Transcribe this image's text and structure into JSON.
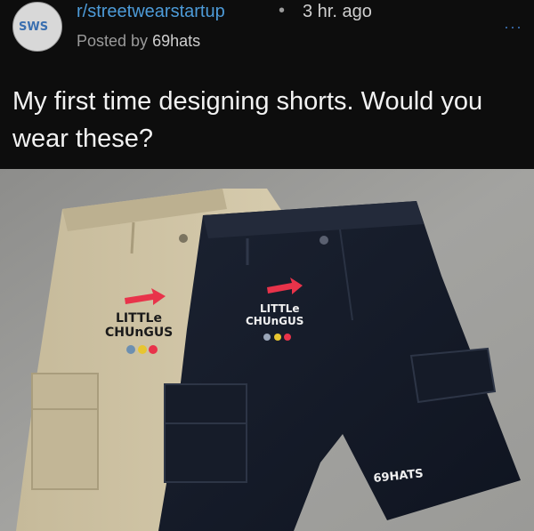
{
  "post": {
    "subreddit": "r/streetwearstartup",
    "separator": "•",
    "time": "3 hr. ago",
    "posted_by_prefix": "Posted by ",
    "author": "69hats",
    "title": "My first time designing shorts. Would you wear these?",
    "more_icon": "ellipsis-icon"
  },
  "avatar": {
    "text": "SWS"
  },
  "image": {
    "description_icon": "photo",
    "khaki_shorts": {
      "line1": "LITTLe",
      "line2": "CHUnGUS"
    },
    "black_shorts": {
      "line1": "LITTLe",
      "line2": "CHUnGUS",
      "brand": "69HATS"
    }
  },
  "colors": {
    "background": "#0d0d0d",
    "subreddit_link": "#4d9bd8",
    "accent_red": "#e8334a",
    "khaki": "#cbbf9f",
    "navy": "#141a26"
  }
}
